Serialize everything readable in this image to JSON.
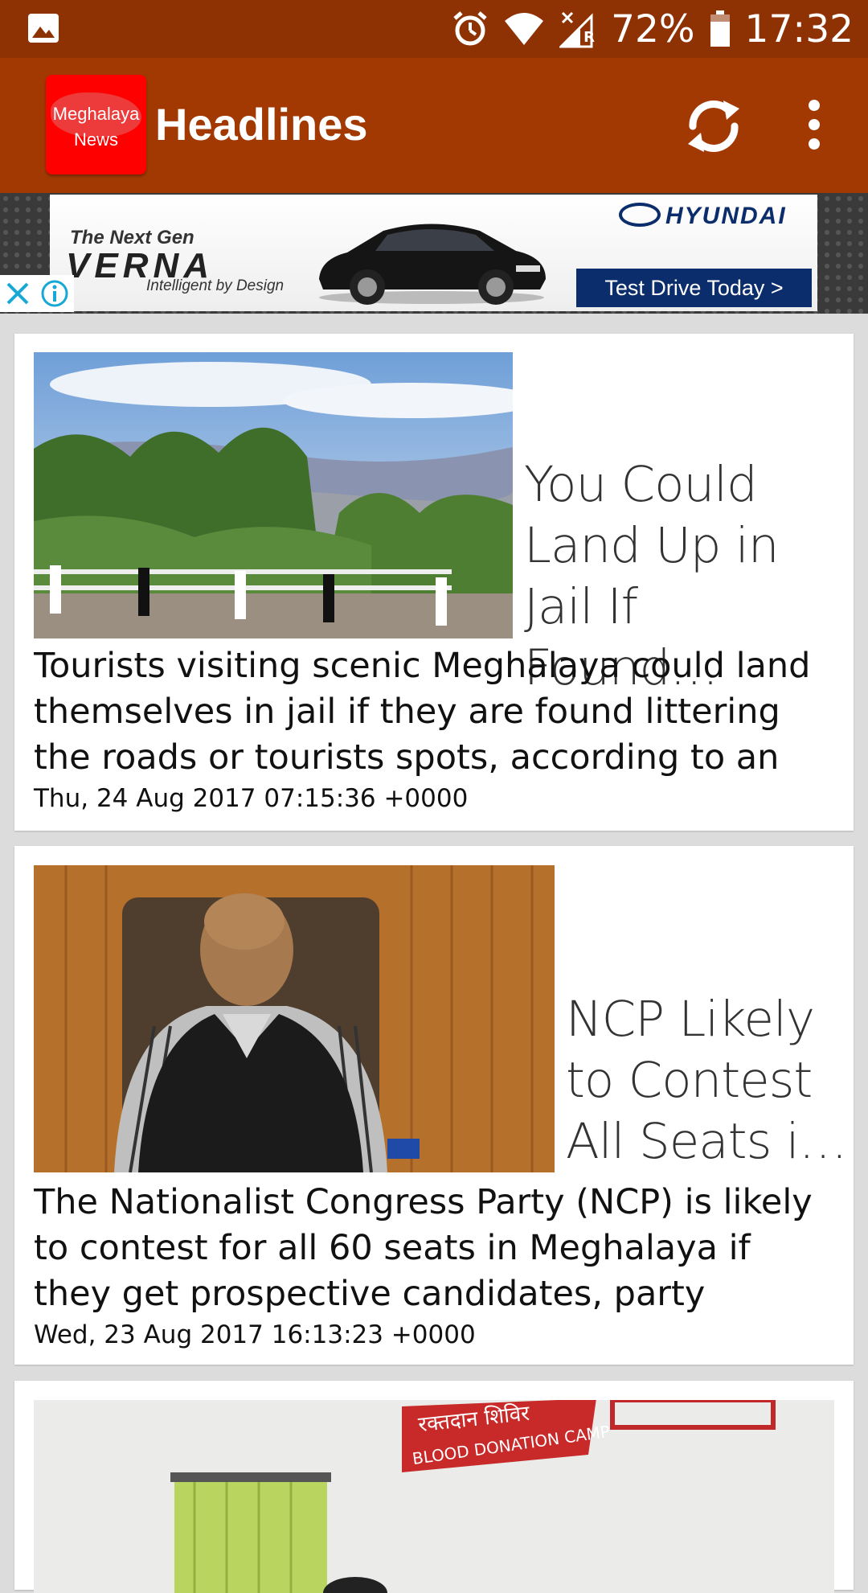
{
  "status_bar": {
    "battery": "72%",
    "time": "17:32",
    "network_indicator": "R",
    "colors": {
      "background": "#8f3203"
    }
  },
  "app_bar": {
    "logo_line1": "Meghalaya",
    "logo_line2": "News",
    "title": "Headlines",
    "refresh_icon": "refresh-icon",
    "more_icon": "more-vert-icon",
    "colors": {
      "background": "#a23903",
      "logo": "#ff0000"
    }
  },
  "ad": {
    "nextgen": "The Next Gen",
    "model": "VERNA",
    "tagline": "Intelligent by Design",
    "brand": "HYUNDAI",
    "cta": "Test Drive Today >",
    "close_icon": "close-icon",
    "info_icon": "info-icon"
  },
  "feed": {
    "items": [
      {
        "headline_lines": [
          "You Could",
          "Land Up in",
          "Jail If Found…"
        ],
        "summary": "Tourists visiting scenic Meghalaya could land themselves in jail if they are found littering the roads or tourists spots, according to an",
        "date": "Thu, 24 Aug 2017 07:15:36 +0000"
      },
      {
        "headline_lines": [
          "NCP Likely",
          "to Contest",
          "All Seats i…"
        ],
        "summary": "The Nationalist Congress Party (NCP) is likely to contest for all 60 seats in Meghalaya if they get prospective candidates, party",
        "date": "Wed, 23 Aug 2017 16:13:23 +0000"
      },
      {
        "image_sign_top": "रक्तदान शिविर",
        "image_sign_bottom": "BLOOD DONATION CAMP"
      }
    ]
  }
}
